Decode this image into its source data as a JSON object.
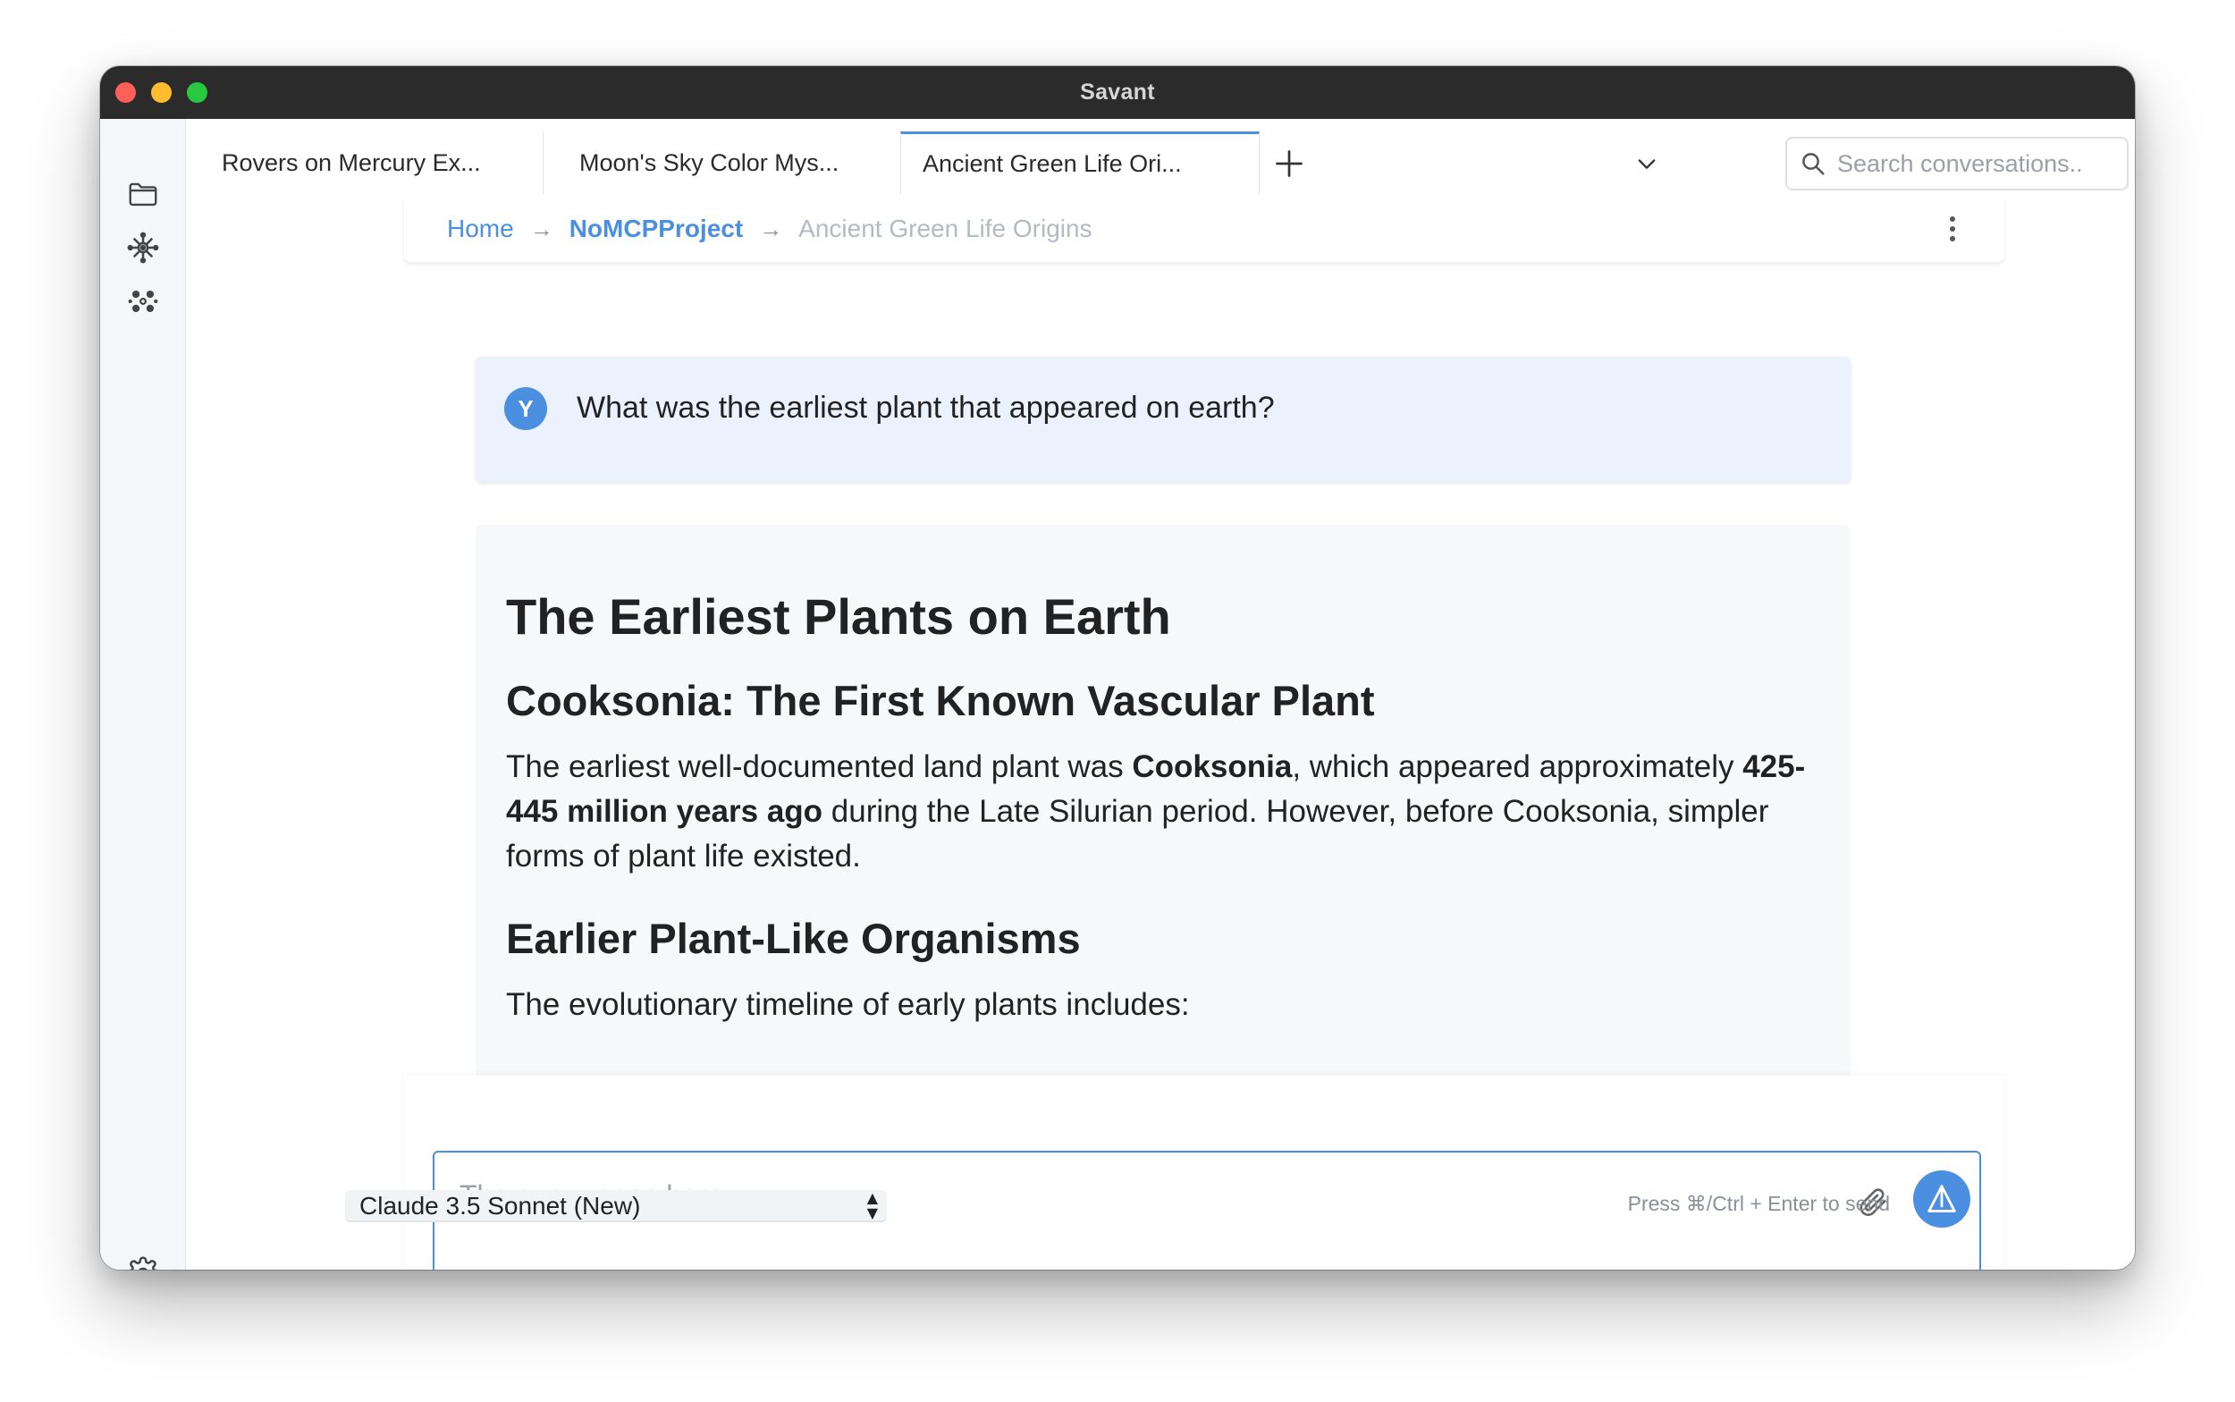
{
  "window": {
    "title": "Savant"
  },
  "sidebar": {
    "top_icons": [
      "folder-icon",
      "network-icon",
      "cluster-icon"
    ],
    "bottom_icon": "gear-icon"
  },
  "tabs": [
    {
      "label": "Rovers on Mercury Ex...",
      "active": false
    },
    {
      "label": "Moon's Sky Color Mys...",
      "active": false
    },
    {
      "label": "Ancient Green Life Ori...",
      "active": true
    }
  ],
  "search": {
    "placeholder": "Search conversations.."
  },
  "breadcrumb": {
    "home": "Home",
    "project": "NoMCPProject",
    "current": "Ancient Green Life Origins"
  },
  "user_message": {
    "avatar_letter": "Y",
    "text": "What was the earliest plant that appeared on earth?"
  },
  "assistant_message": {
    "heading": "The Earliest Plants on Earth",
    "section1_heading": "Cooksonia: The First Known Vascular Plant",
    "para1": {
      "t1": "The earliest well-documented land plant was ",
      "b1": "Cooksonia",
      "t2": ", which appeared approximately ",
      "b2": "425-445 million years ago",
      "t3": " during the Late Silurian period. However, before Cooksonia, simpler forms of plant life existed."
    },
    "section2_heading": "Earlier Plant-Like Organisms",
    "para2": "The evolutionary timeline of early plants includes:"
  },
  "composer": {
    "placeholder": "The query goes here",
    "value": "",
    "model_options": [
      "Claude 3.5 Sonnet (New)"
    ],
    "model_selected": "Claude 3.5 Sonnet (New)",
    "hint": "Press ⌘/Ctrl + Enter to send"
  },
  "colors": {
    "accent": "#4a8fe0",
    "user_bubble": "#ebf2fe",
    "assistant_bubble": "#f7f8fa",
    "titlebar": "#2b2b2b"
  }
}
